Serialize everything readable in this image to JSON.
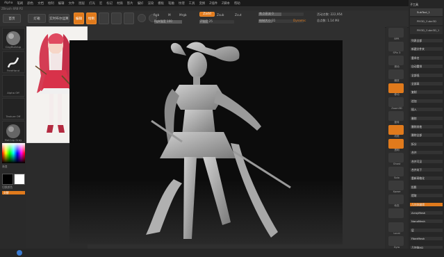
{
  "app": {
    "title_left": "ZBrush",
    "version_line": "ZBrush 4R8 P2"
  },
  "menubar": {
    "items": [
      "Alpha",
      "笔刷",
      "颜色",
      "文档",
      "绘制",
      "编辑",
      "文件",
      "图层",
      "灯光",
      "宏",
      "标记",
      "材质",
      "影片",
      "偏好",
      "渲染",
      "模板",
      "笔触",
      "纹理",
      "工具",
      "变换",
      "Z插件",
      "Z脚本",
      "帮助"
    ],
    "right_items": [
      "菜单",
      "默认Z脚本"
    ]
  },
  "toolbar": {
    "home_label": "首页",
    "lightbox_label": "灯箱",
    "live_boolean_label": "实时布尔运算",
    "edit_label": "编辑",
    "draw_label": "绘制",
    "rgb_label": "Rgb",
    "m_label": "M",
    "mrgb_label": "Mrgb",
    "zadd_label": "Zadd",
    "zsub_label": "Zsub",
    "zcut_label": "Zcut",
    "z_intensity_label": "Z强度 25",
    "rgb_intensity_label": "Rgb强度 100",
    "focal_shift_label": "焦点衰减 0",
    "draw_size_label": "绘制大小 31",
    "dynamic_label": "Dynamic",
    "active_points_label": "活动点数: 222,954",
    "total_points_label": "总点数: 1.14 Mil"
  },
  "toolbar_values": {
    "z_intensity": 0.25,
    "rgb_intensity": 1.0,
    "focal_shift": 0.5,
    "draw_size": 0.3
  },
  "leftpanel": {
    "brush_label": "ClayBuildup",
    "stroke_label": "FreeHand",
    "alpha_label": "Alpha Off",
    "texture_label": "Texture Off",
    "material_label": "MatCap Gray",
    "gradient_label": "渐变",
    "switch_color_label": "切换颜色",
    "alternate_label": "交替"
  },
  "rightnav": {
    "items": [
      "BPR",
      "SPix 3",
      "滚动",
      "缩放",
      "移动",
      "Zoom3D",
      "旋转",
      "线框",
      "透明",
      "Ghost",
      "Solo",
      "Xpose",
      "动态",
      "",
      "Local",
      "Gyro"
    ]
  },
  "rightpanel": {
    "title": "子工具",
    "subtools": [
      "SubTool_1",
      "PM3D_Cube3D",
      "PM3D_Cube3D_1"
    ],
    "rows": [
      "列表全部",
      "新建文件夹",
      "重命名",
      "自动重排",
      "全部低",
      "全部高",
      "复制",
      "追加",
      "插入",
      "删除",
      "删除其他",
      "删除全部",
      "拆分",
      "合并",
      "合并可见",
      "合并向下",
      "重新网格化",
      "投影",
      "提取",
      "几何体编辑",
      "ArrayMesh",
      "NanoMesh",
      "层",
      "FiberMesh",
      "几何体HD"
    ]
  },
  "colors": {
    "accent": "#e07a1c",
    "panel": "#2a2a2a",
    "viewport": "#0c0c0c"
  }
}
